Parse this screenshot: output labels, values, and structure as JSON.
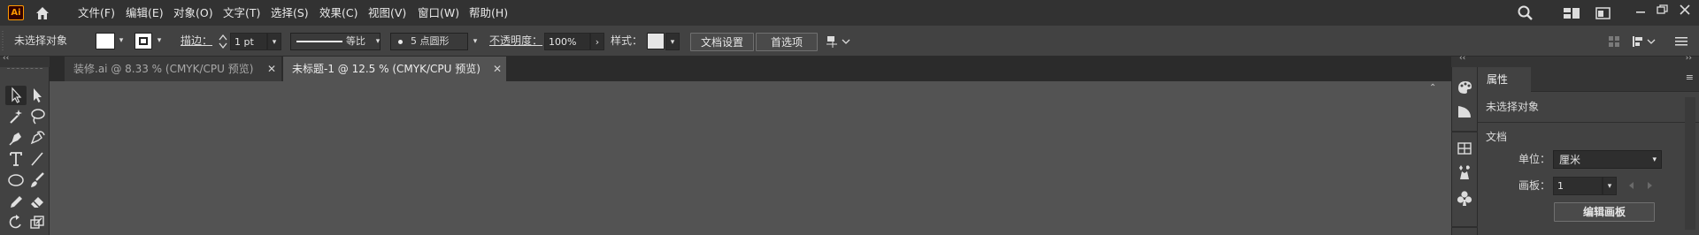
{
  "app": {
    "logo_text": "Ai",
    "menus": [
      "文件(F)",
      "编辑(E)",
      "对象(O)",
      "文字(T)",
      "选择(S)",
      "效果(C)",
      "视图(V)",
      "窗口(W)",
      "帮助(H)"
    ]
  },
  "control_bar": {
    "selection_status": "未选择对象",
    "stroke_label": "描边：",
    "stroke_value": "1 pt",
    "profile_label": "等比",
    "brush_label": "5 点圆形",
    "opacity_label": "不透明度：",
    "opacity_value": "100%",
    "style_label": "样式：",
    "doc_setup_button": "文档设置",
    "preferences_button": "首选项"
  },
  "tabs": [
    {
      "label": "装修.ai @ 8.33 % (CMYK/CPU 预览)",
      "active": false
    },
    {
      "label": "未标题-1 @ 12.5 % (CMYK/CPU 预览)",
      "active": true
    }
  ],
  "properties_panel": {
    "tab_label": "属性",
    "selection_status": "未选择对象",
    "section_document": "文档",
    "units_label": "单位：",
    "units_value": "厘米",
    "artboard_label": "画板：",
    "artboard_value": "1",
    "edit_artboards_button": "编辑画板"
  },
  "icons": {
    "window_controls": [
      "minimize-icon",
      "restore-icon",
      "close-icon"
    ],
    "toolbar": [
      "selection-tool-icon",
      "direct-selection-tool-icon",
      "magic-wand-tool-icon",
      "lasso-tool-icon",
      "pen-tool-icon",
      "curvature-tool-icon",
      "type-tool-icon",
      "line-segment-tool-icon",
      "ellipse-tool-icon",
      "paintbrush-tool-icon",
      "pencil-tool-icon",
      "eraser-tool-icon",
      "rotate-tool-icon",
      "scale-tool-icon"
    ],
    "dock": [
      "color-panel-icon",
      "gradient-panel-icon",
      "swatches-panel-icon",
      "symbols-panel-icon",
      "club-icon"
    ]
  },
  "colors": {
    "menubar_bg": "#323232",
    "controlbar_bg": "#424242",
    "canvas_bg": "#535353",
    "logo_accent": "#ff9a00"
  }
}
